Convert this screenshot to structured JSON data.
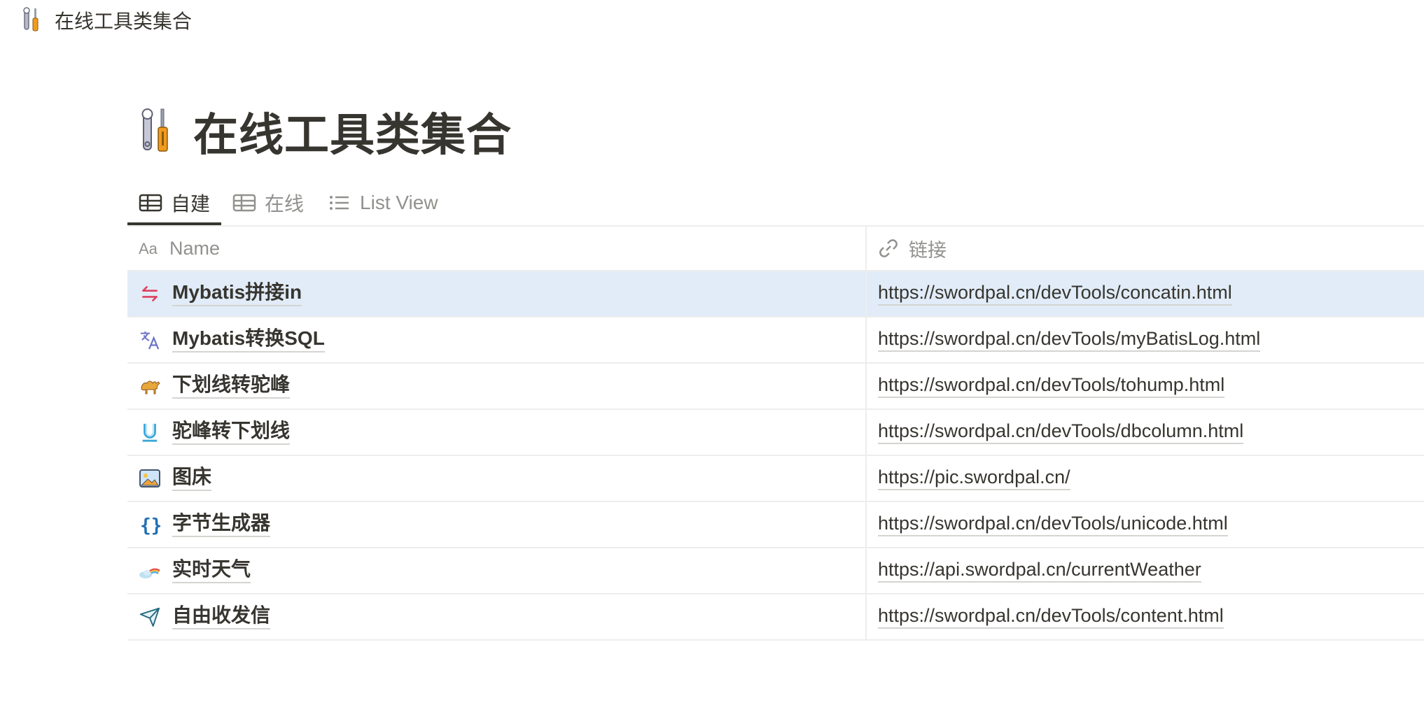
{
  "breadcrumb": {
    "title": "在线工具类集合",
    "icon": "tools-icon"
  },
  "page": {
    "title": "在线工具类集合",
    "icon": "tools-icon"
  },
  "tabs": [
    {
      "label": "自建",
      "icon": "table-icon",
      "active": true
    },
    {
      "label": "在线",
      "icon": "table-icon",
      "active": false
    },
    {
      "label": "List View",
      "icon": "list-icon",
      "active": false
    }
  ],
  "table": {
    "columns": [
      {
        "label": "Name",
        "icon": "text-property-icon"
      },
      {
        "label": "链接",
        "icon": "link-icon"
      }
    ],
    "rows": [
      {
        "name": "Mybatis拼接in",
        "link": "https://swordpal.cn/devTools/concatin.html",
        "icon": "swap-arrows-icon",
        "selected": true
      },
      {
        "name": "Mybatis转换SQL",
        "link": "https://swordpal.cn/devTools/myBatisLog.html",
        "icon": "translate-icon",
        "selected": false
      },
      {
        "name": "下划线转驼峰",
        "link": "https://swordpal.cn/devTools/tohump.html",
        "icon": "camel-icon",
        "selected": false
      },
      {
        "name": "驼峰转下划线",
        "link": "https://swordpal.cn/devTools/dbcolumn.html",
        "icon": "underline-icon",
        "selected": false
      },
      {
        "name": "图床",
        "link": "https://pic.swordpal.cn/",
        "icon": "picture-icon",
        "selected": false
      },
      {
        "name": "字节生成器",
        "link": "https://swordpal.cn/devTools/unicode.html",
        "icon": "braces-icon",
        "selected": false
      },
      {
        "name": "实时天气",
        "link": "https://api.swordpal.cn/currentWeather",
        "icon": "weather-rainbow-icon",
        "selected": false
      },
      {
        "name": "自由收发信",
        "link": "https://swordpal.cn/devTools/content.html",
        "icon": "paper-plane-icon",
        "selected": false
      }
    ]
  },
  "colors": {
    "text": "#37352f",
    "muted": "#91918e",
    "selected_row": "#e1ecf8",
    "divider": "#ededec"
  }
}
